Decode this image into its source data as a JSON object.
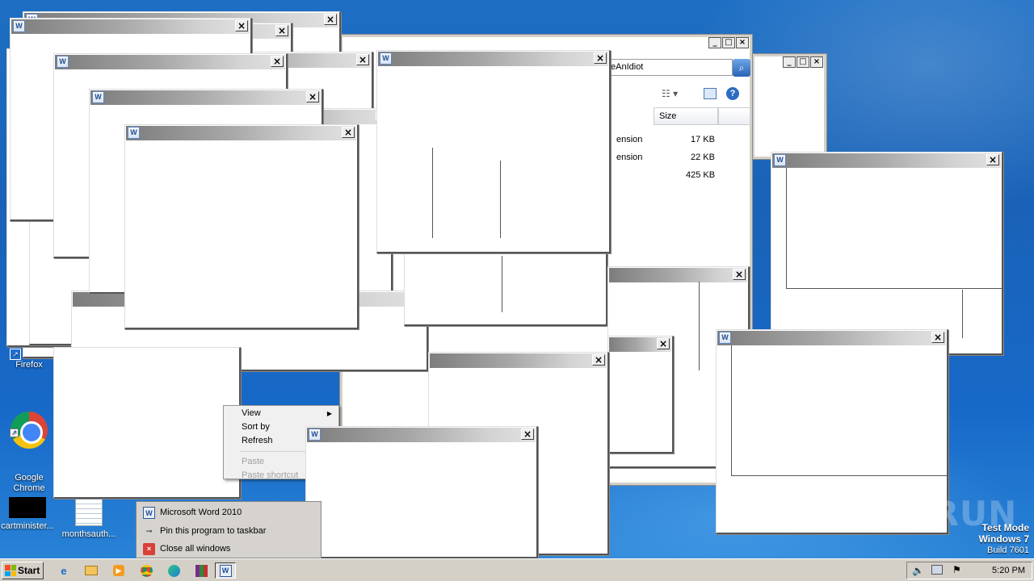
{
  "desktop": {
    "icons": [
      {
        "label": "Firefox"
      },
      {
        "label": "Google\nChrome"
      },
      {
        "label": "cartminister..."
      },
      {
        "label": "monthsauth..."
      }
    ]
  },
  "explorer": {
    "address_fragment": "eAnIdiot",
    "column_size": "Size",
    "rows": [
      {
        "type": "ension",
        "size": "17 KB"
      },
      {
        "type": "ension",
        "size": "22 KB"
      },
      {
        "type": "",
        "size": "425 KB"
      }
    ]
  },
  "context_menu": {
    "view": "View",
    "sort_by": "Sort by",
    "refresh": "Refresh",
    "paste": "Paste",
    "paste_shortcut": "Paste shortcut"
  },
  "jump_list": {
    "app": "Microsoft Word 2010",
    "pin": "Pin this program to taskbar",
    "close_all": "Close all windows"
  },
  "taskbar": {
    "start": "Start",
    "clock": "5:20 PM"
  },
  "watermark": "ANY RUN",
  "test_mode": {
    "line1": "Test Mode",
    "line2": "Windows 7",
    "line3": "Build 7601"
  },
  "window_icon_letter": "W",
  "close_glyph": "×"
}
